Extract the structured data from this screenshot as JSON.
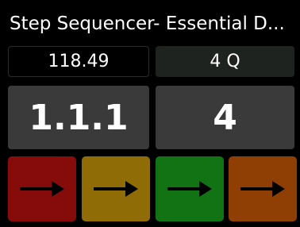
{
  "header": {
    "title": "Step Sequencer- Essential D..."
  },
  "transport": {
    "tempo": "118.49",
    "time_signature": "4 Q",
    "position": "1.1.1",
    "steps": "4"
  },
  "buttons": [
    {
      "icon": "arrow-right-icon",
      "color": "#860c0c"
    },
    {
      "icon": "arrow-right-icon",
      "color": "#8f6c05"
    },
    {
      "icon": "arrow-right-icon",
      "color": "#117313"
    },
    {
      "icon": "arrow-right-icon",
      "color": "#8f3f03"
    }
  ]
}
